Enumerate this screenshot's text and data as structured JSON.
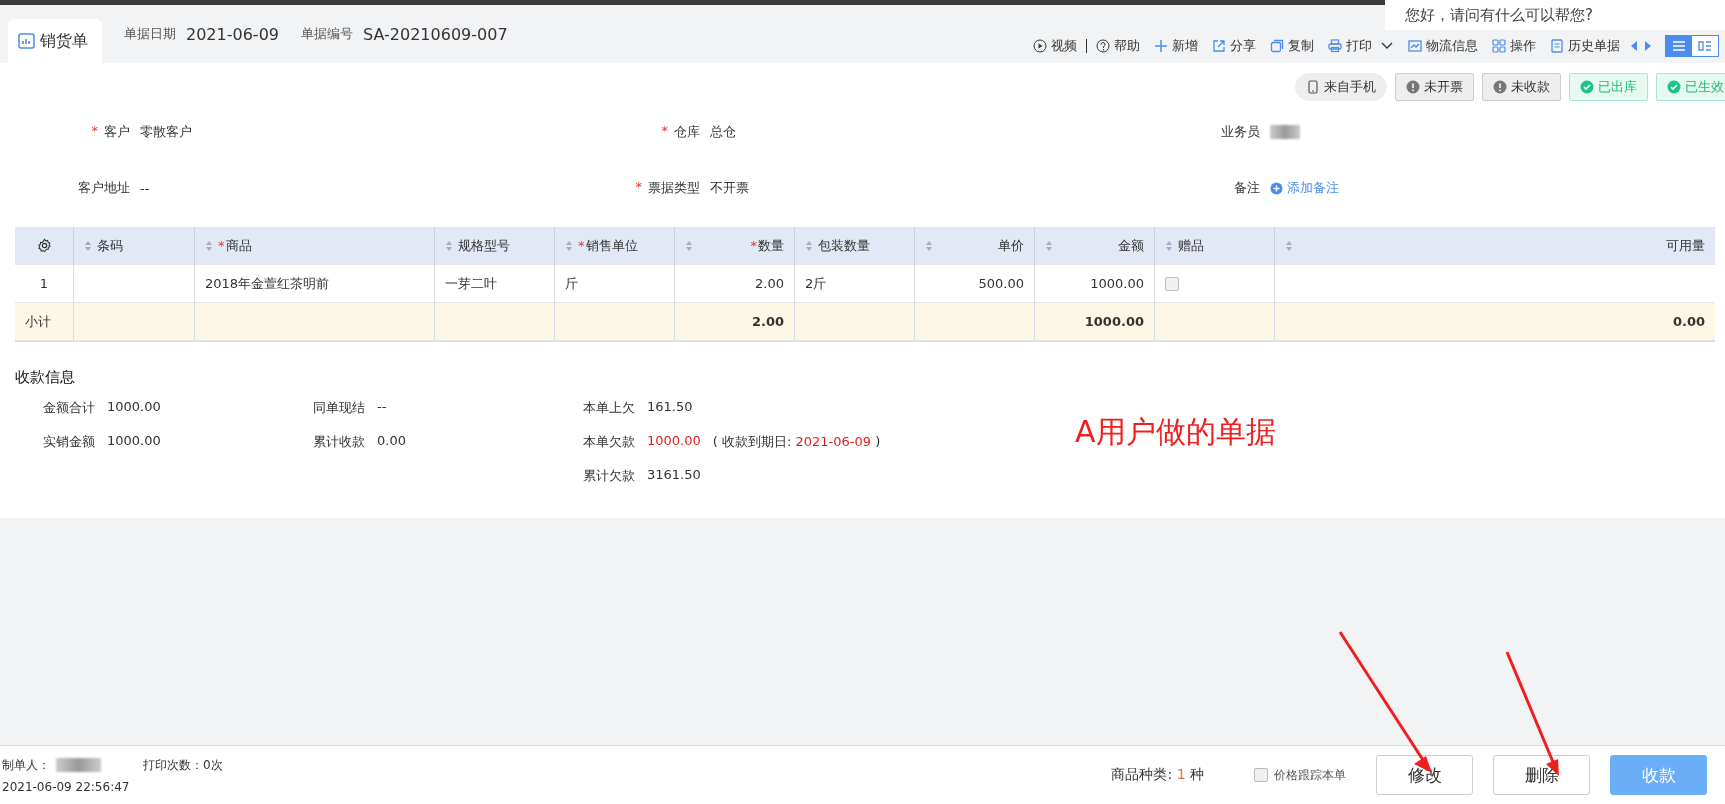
{
  "header": {
    "title": "销货单",
    "date_label": "单据日期",
    "date": "2021-06-09",
    "number_label": "单据编号",
    "number": "SA-20210609-007"
  },
  "toolbar": [
    {
      "label": "视频"
    },
    {
      "label": "帮助"
    },
    {
      "label": "新增"
    },
    {
      "label": "分享"
    },
    {
      "label": "复制"
    },
    {
      "label": "打印"
    },
    {
      "label": "物流信息"
    },
    {
      "label": "操作"
    },
    {
      "label": "历史单据"
    }
  ],
  "view_toggle": [
    {
      "selected": true
    },
    {
      "selected": false
    }
  ],
  "chat_bubble": "您好，请问有什么可以帮您?",
  "status_tags": [
    {
      "label": "来自手机",
      "kind": "source"
    },
    {
      "label": "未开票",
      "kind": "pending"
    },
    {
      "label": "未收款",
      "kind": "pending"
    },
    {
      "label": "已出库",
      "kind": "done"
    },
    {
      "label": "已生效",
      "kind": "done"
    }
  ],
  "fields": [
    {
      "mark": "*",
      "label": "客户",
      "value": "零散客户"
    },
    {
      "mark": "*",
      "label": "仓库",
      "value": "总仓"
    },
    {
      "label": "业务员"
    },
    {
      "label": "客户地址",
      "value": "--"
    },
    {
      "mark": "*",
      "label": "票据类型",
      "value": "不开票"
    },
    {
      "label": "备注",
      "link": "添加备注"
    }
  ],
  "table": {
    "columns": [
      {
        "label": "条码"
      },
      {
        "mark": "*",
        "label": "商品"
      },
      {
        "label": "规格型号"
      },
      {
        "mark": "*",
        "label": "销售单位"
      },
      {
        "mark": "*",
        "label": "数量"
      },
      {
        "label": "包装数量"
      },
      {
        "label": "单价"
      },
      {
        "label": "金额"
      },
      {
        "label": "赠品"
      },
      {
        "label": "可用量"
      }
    ],
    "rows": [
      {
        "index": "1",
        "cells": [
          "",
          "2018年金萱红茶明前",
          "一芽二叶",
          "斤",
          "2.00",
          "2斤",
          "500.00",
          "1000.00",
          null,
          ""
        ],
        "gift": false
      }
    ],
    "subtotal": {
      "label": "小计",
      "cells": [
        "",
        "",
        "",
        "",
        "2.00",
        "",
        "",
        "1000.00",
        "",
        "0.00"
      ]
    }
  },
  "payment": {
    "title": "收款信息",
    "items": [
      {
        "label": "金额合计",
        "value": "1000.00"
      },
      {
        "label": "同单现结",
        "value": "--"
      },
      {
        "label": "本单上欠",
        "value": "161.50"
      },
      {
        "label": "实销金额",
        "value": "1000.00"
      },
      {
        "label": "累计收款",
        "value": "0.00"
      },
      {
        "label": "本单欠款",
        "value": "1000.00",
        "due_label": "( 收款到期日:",
        "due": "2021-06-09",
        "due_close": ")"
      },
      {
        "label": "累计欠款",
        "value": "3161.50"
      }
    ]
  },
  "annotation": "A用户做的单据",
  "footer": {
    "maker_label": "制单人：",
    "print_count": "打印次数：0次",
    "time": "2021-06-09 22:56:47",
    "kinds_label": "商品种类:",
    "kinds_value": "1",
    "kinds_unit": "种",
    "track": {
      "label": "价格跟踪本单",
      "checked": false
    },
    "buttons": [
      {
        "label": "修改",
        "primary": false
      },
      {
        "label": "删除",
        "primary": false
      },
      {
        "label": "收款",
        "primary": true
      }
    ]
  }
}
